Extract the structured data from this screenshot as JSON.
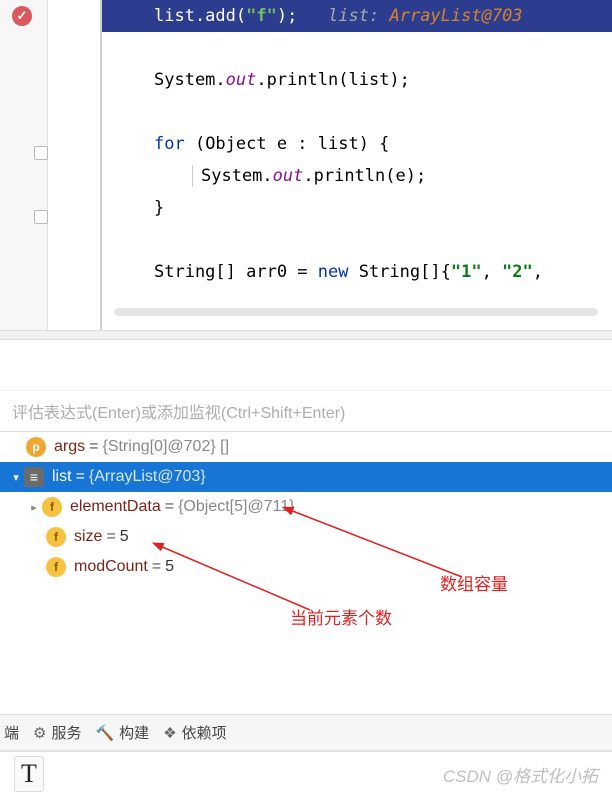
{
  "editor": {
    "exec_line": {
      "code_prefix": "list.add(",
      "code_str": "\"f\"",
      "code_suffix": ");",
      "inlay_label": "list:",
      "inlay_value": "ArrayList@703"
    },
    "lines": {
      "println_list": {
        "prefix": "System.",
        "out": "out",
        "suffix": ".println(list);"
      },
      "for_open": {
        "kw1": "for",
        "mid": " (Object e : list) {"
      },
      "println_e": {
        "prefix": "System.",
        "out": "out",
        "suffix": ".println(e);"
      },
      "brace_close": "}",
      "arr_decl": {
        "p1": "String[] arr0 = ",
        "kw": "new",
        "p2": " String[]{",
        "s1": "\"1\"",
        "c": ", ",
        "s2": "\"2\"",
        "tail": ","
      }
    }
  },
  "evaluate_placeholder": "评估表达式(Enter)或添加监视(Ctrl+Shift+Enter)",
  "debug": {
    "args": {
      "name": "args",
      "value": "{String[0]@702} []"
    },
    "list": {
      "name": "list",
      "value": "{ArrayList@703}"
    },
    "elementData": {
      "name": "elementData",
      "value": "{Object[5]@711}"
    },
    "size": {
      "name": "size",
      "value": "5"
    },
    "modCount": {
      "name": "modCount",
      "value": "5"
    }
  },
  "annotations": {
    "capacity": "数组容量",
    "count": "当前元素个数"
  },
  "tool_tabs": {
    "t0": "端",
    "t1": "服务",
    "t2": "构建",
    "t3": "依赖项"
  },
  "watermark": "CSDN @格式化小拓"
}
